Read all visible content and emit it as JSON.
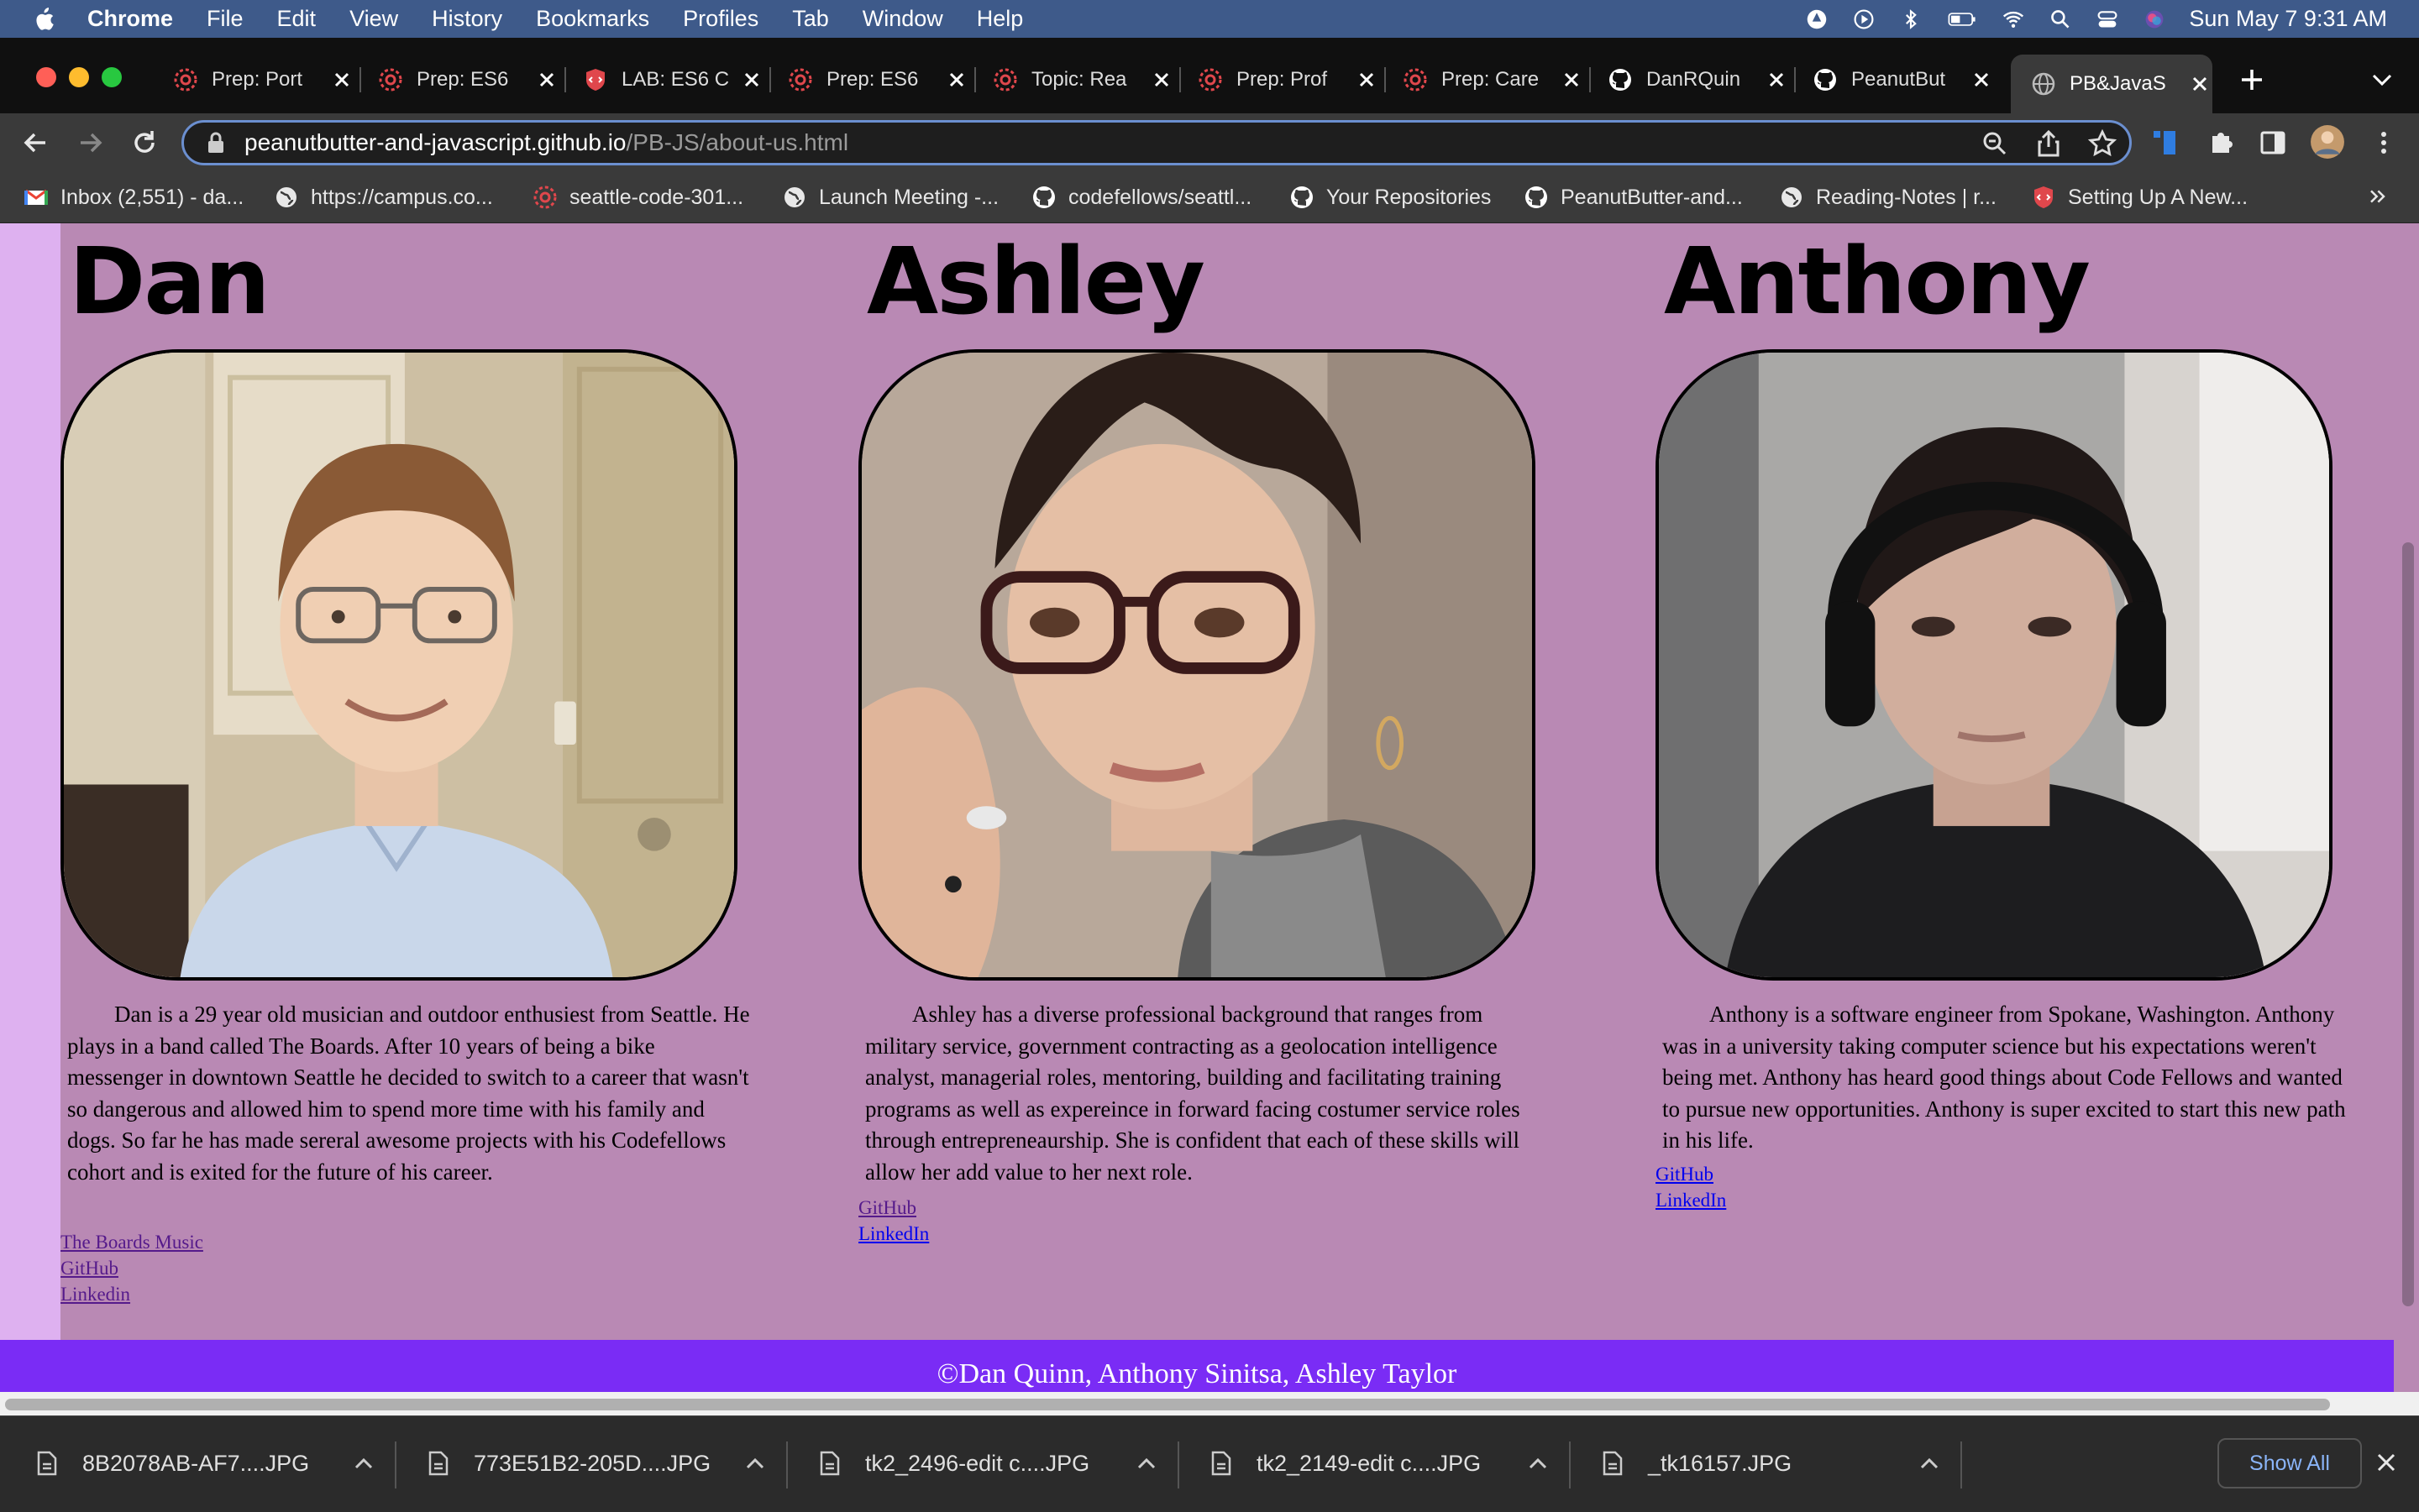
{
  "menubar": {
    "app": "Chrome",
    "items": [
      "File",
      "Edit",
      "View",
      "History",
      "Bookmarks",
      "Profiles",
      "Tab",
      "Window",
      "Help"
    ],
    "clock": "Sun May 7  9:31 AM"
  },
  "tabs": [
    {
      "title": "Prep: Port",
      "favicon": "codefellows-icon"
    },
    {
      "title": "Prep: ES6",
      "favicon": "codefellows-icon"
    },
    {
      "title": "LAB: ES6 C",
      "favicon": "lab-shield-icon"
    },
    {
      "title": "Prep: ES6",
      "favicon": "codefellows-icon"
    },
    {
      "title": "Topic: Rea",
      "favicon": "codefellows-icon"
    },
    {
      "title": "Prep: Prof",
      "favicon": "codefellows-icon"
    },
    {
      "title": "Prep: Care",
      "favicon": "codefellows-icon"
    },
    {
      "title": "DanRQuin",
      "favicon": "github-icon"
    },
    {
      "title": "PeanutBut",
      "favicon": "github-icon"
    },
    {
      "title": "PB&JavaS",
      "favicon": "globe-icon",
      "active": true
    }
  ],
  "address": {
    "host": "peanutbutter-and-javascript.github.io",
    "path": "/PB-JS/about-us.html"
  },
  "bookmarks": [
    {
      "label": "Inbox (2,551) - da...",
      "icon": "gmail-icon"
    },
    {
      "label": "https://campus.co...",
      "icon": "globe-icon"
    },
    {
      "label": "seattle-code-301...",
      "icon": "codefellows-icon"
    },
    {
      "label": "Launch Meeting -...",
      "icon": "globe-icon"
    },
    {
      "label": "codefellows/seattl...",
      "icon": "github-icon"
    },
    {
      "label": "Your Repositories",
      "icon": "github-icon"
    },
    {
      "label": "PeanutButter-and...",
      "icon": "github-icon"
    },
    {
      "label": "Reading-Notes | r...",
      "icon": "globe-icon"
    },
    {
      "label": "Setting Up A New...",
      "icon": "lab-shield-icon"
    }
  ],
  "people": [
    {
      "name": "Dan",
      "bio": "Dan is a 29 year old musician and outdoor enthusiest from Seattle. He plays in a band called The Boards. After 10 years of being a bike messenger in downtown Seattle he decided to switch to a career that wasn't so dangerous and allowed him to spend more time with his family and dogs. So far he has made sereral awesome projects with his Codefellows cohort and is exited for the future of his career.",
      "links": [
        "The Boards Music",
        "GitHub",
        "Linkedin"
      ]
    },
    {
      "name": "Ashley",
      "bio": "Ashley has a diverse professional background that ranges from military service, government contracting as a geolocation intelligence analyst, managerial roles, mentoring, building and facilitating training programs as well as expereince in forward facing costumer service roles through entrepreneaurship. She is confident that each of these skills will allow her add value to her next role.",
      "links": [
        "GitHub",
        "LinkedIn"
      ]
    },
    {
      "name": "Anthony",
      "bio": "Anthony is a software engineer from Spokane, Washington. Anthony was in a university taking computer science but his expectations weren't being met. Anthony has heard good things about Code Fellows and wanted to pursue new opportunities. Anthony is super excited to start this new path in his life.",
      "links": [
        "GitHub",
        "LinkedIn"
      ]
    }
  ],
  "footer": "©Dan Quinn, Anthony Sinitsa, Ashley Taylor",
  "downloads": {
    "files": [
      "8B2078AB-AF7....JPG",
      "773E51B2-205D....JPG",
      "tk2_2496-edit c....JPG",
      "tk2_2149-edit c....JPG",
      "_tk16157.JPG"
    ],
    "show_all": "Show All"
  },
  "colors": {
    "page_bg": "#b989b4",
    "left_strip": "#deb1f0",
    "footer_bg": "#7a2cf5",
    "link_visited": "#551a8b",
    "link": "#0000ee"
  }
}
